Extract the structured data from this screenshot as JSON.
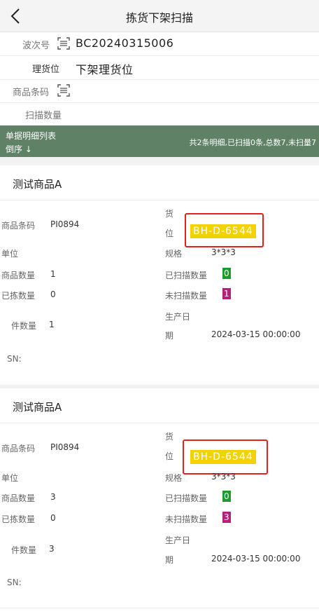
{
  "header": {
    "title": "拣货下架扫描",
    "back_icon": "chevron-left-icon"
  },
  "form": {
    "wave_label": "波次号",
    "wave_value": "BC20240315006",
    "location_label": "理货位",
    "location_value": "下架理货位",
    "barcode_label": "商品条码",
    "barcode_value": "",
    "qty_label": "扫描数量",
    "qty_value": ""
  },
  "list_header": {
    "title_line1": "单据明细列表",
    "title_line2": "倒序 ↓",
    "summary": "共2条明细,已扫描0条,总数7,未扫量7"
  },
  "labels": {
    "barcode": "商品条码",
    "unit": "单位",
    "goods_qty": "商品数量",
    "picked_qty": "已拣数量",
    "piece_qty": "件数量",
    "sn": "SN:",
    "location_line1": "货",
    "location_line2": "位",
    "spec": "规格",
    "scanned_qty": "已扫描数量",
    "unscanned_qty": "未扫描数量",
    "prod_date_line1": "生产日",
    "prod_date_line2": "期"
  },
  "items": [
    {
      "name": "测试商品A",
      "barcode": "PI0894",
      "unit": "",
      "goods_qty": "1",
      "picked_qty": "0",
      "piece_qty": "1",
      "sn": "",
      "location": "BH-D-6544",
      "spec": "3*3*3",
      "scanned_qty": "0",
      "unscanned_qty": "1",
      "prod_date": "2024-03-15 00:00:00"
    },
    {
      "name": "测试商品A",
      "barcode": "PI0894",
      "unit": "",
      "goods_qty": "3",
      "picked_qty": "0",
      "piece_qty": "3",
      "sn": "",
      "location": "BH-D-6544",
      "spec": "3*3*3",
      "scanned_qty": "0",
      "unscanned_qty": "3",
      "prod_date": "2024-03-15 00:00:00"
    }
  ],
  "colors": {
    "header_bg": "#f4f4f4",
    "green_bar": "#5f8166",
    "location_tag": "#f2d200",
    "highlight_box": "#e22222",
    "scanned_badge": "#1e9a2c",
    "unscanned_badge": "#b5207a"
  }
}
